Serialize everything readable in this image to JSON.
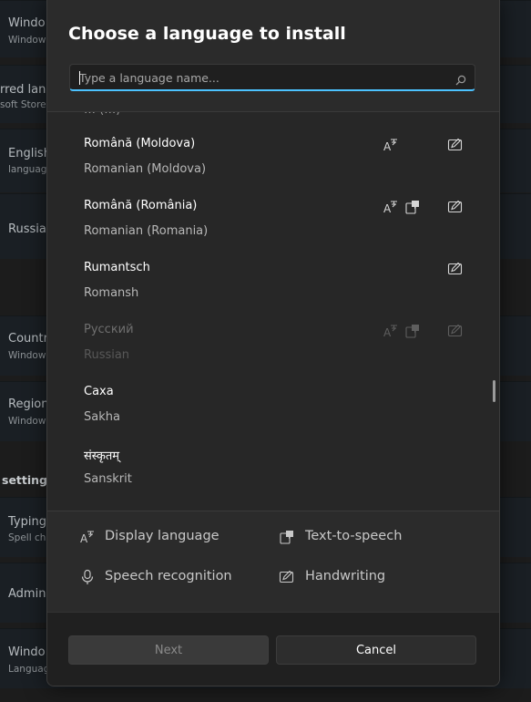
{
  "background": {
    "items": [
      {
        "title": "Windo",
        "subtitle": "Window"
      },
      {
        "title": "rred lang",
        "subtitle": "soft Store"
      },
      {
        "title": "English",
        "subtitle": "languag"
      },
      {
        "title": "Russian",
        "subtitle": ""
      },
      {
        "title": "Countr",
        "subtitle": "Window"
      },
      {
        "title": "Region",
        "subtitle": "Window"
      },
      {
        "title": "Typing",
        "subtitle": "Spell ch"
      },
      {
        "title": "Admin",
        "subtitle": ""
      },
      {
        "title": "Windo",
        "subtitle": "Languag"
      }
    ],
    "section_heading": "settings"
  },
  "dialog": {
    "title": "Choose a language to install",
    "search": {
      "placeholder": "Type a language name..."
    },
    "partial_row": "… (…)",
    "languages": [
      {
        "native": "Română (Moldova)",
        "english": "Romanian (Moldova)",
        "features": [
          "display-language",
          "handwriting"
        ],
        "disabled": false
      },
      {
        "native": "Română (România)",
        "english": "Romanian (Romania)",
        "features": [
          "display-language",
          "text-to-speech",
          "handwriting"
        ],
        "disabled": false
      },
      {
        "native": "Rumantsch",
        "english": "Romansh",
        "features": [
          "handwriting"
        ],
        "disabled": false
      },
      {
        "native": "Русский",
        "english": "Russian",
        "features": [
          "display-language",
          "text-to-speech",
          "handwriting"
        ],
        "disabled": true
      },
      {
        "native": "Саха",
        "english": "Sakha",
        "features": [],
        "disabled": false
      },
      {
        "native": "संस्कृतम्",
        "english": "Sanskrit",
        "features": [],
        "disabled": false
      }
    ],
    "legend": {
      "display_language": "Display language",
      "text_to_speech": "Text-to-speech",
      "speech_recognition": "Speech recognition",
      "handwriting": "Handwriting"
    },
    "buttons": {
      "next": "Next",
      "cancel": "Cancel"
    }
  },
  "colors": {
    "accent": "#4cc2ff",
    "dialog_bg": "#2b2b2b",
    "list_bg": "#272727",
    "footer_bg": "#202020"
  }
}
